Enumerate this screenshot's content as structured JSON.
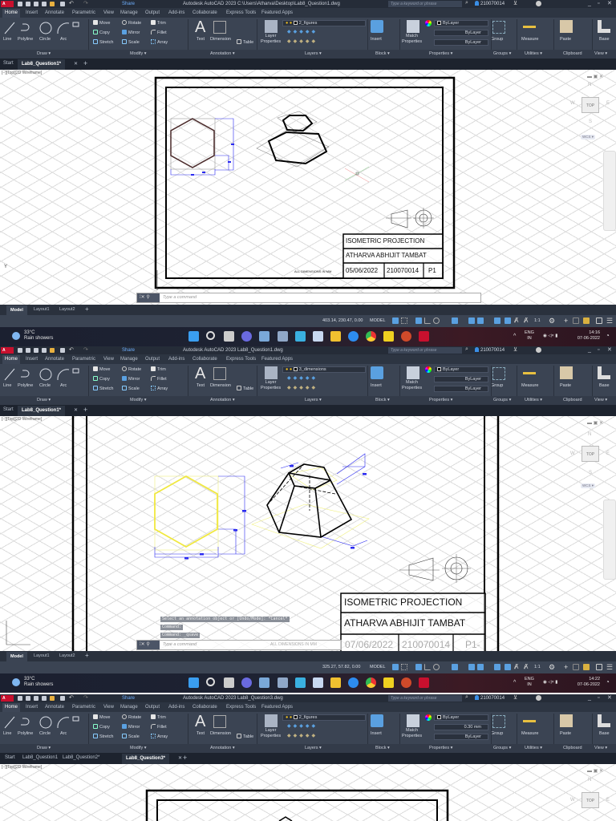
{
  "screens": [
    {
      "window_title": "Autodesk AutoCAD 2023    C:\\Users\\Atharva\\Desktop\\Lab8_Question1.dwg",
      "doc_tabs": [
        "Start",
        "Lab8_Question1*"
      ],
      "active_doc_tab": 1,
      "layer_name": "2_figures",
      "lineweight": "ByLayer",
      "linetype": "ByLayer",
      "color": "ByLayer",
      "coords": "403.14, 230.47, 0.00",
      "clock_time": "14:16",
      "clock_date": "07-06-2022"
    },
    {
      "window_title": "Autodesk AutoCAD 2023    Lab8_Question1.dwg",
      "doc_tabs": [
        "Start",
        "Lab8_Question1*"
      ],
      "active_doc_tab": 1,
      "layer_name": "3_dimensions",
      "lineweight": "ByLayer",
      "linetype": "ByLayer",
      "color": "ByLayer",
      "coords": "325.27, 57.82, 0.00",
      "clock_time": "14:22",
      "clock_date": "07-06-2022"
    },
    {
      "window_title": "Autodesk AutoCAD 2023    Lab8_Question3.dwg",
      "doc_tabs": [
        "Start",
        "Lab8_Question1",
        "Lab8_Question2*",
        "Lab8_Question3*"
      ],
      "active_doc_tab": 3,
      "layer_name": "2_figures",
      "lineweight": "0.30 mm",
      "linetype": "ByLayer",
      "color": "ByLayer"
    }
  ],
  "app": {
    "logo": "A CAD",
    "share": "Share",
    "search_placeholder": "Type a keyword or phrase",
    "user": "210070014",
    "ribbon_tabs": [
      "Home",
      "Insert",
      "Annotate",
      "Parametric",
      "View",
      "Manage",
      "Output",
      "Add-ins",
      "Collaborate",
      "Express Tools",
      "Featured Apps"
    ],
    "draw_tools": [
      "Line",
      "Polyline",
      "Circle",
      "Arc"
    ],
    "modify_tools": [
      "Move",
      "Rotate",
      "Trim",
      "Copy",
      "Mirror",
      "Fillet",
      "Stretch",
      "Scale",
      "Array"
    ],
    "text_tool": "Text",
    "dimension_tool": "Dimension",
    "table_tool": "Table",
    "layer_properties": [
      "Layer",
      "Properties"
    ],
    "insert_tool": "Insert",
    "match_properties": [
      "Match",
      "Properties"
    ],
    "group_tool": "Group",
    "measure_tool": "Measure",
    "paste_tool": "Paste",
    "base_tool": "Base",
    "panel_labels": [
      "Draw ▾",
      "Modify ▾",
      "Annotation ▾",
      "Layers ▾",
      "Block ▾",
      "Properties ▾",
      "Groups ▾",
      "Utilities ▾",
      "Clipboard",
      "View ▾"
    ],
    "viewport_label": "[−][Top][2D Wireframe]",
    "viewcube": {
      "top": "TOP",
      "n": "N",
      "s": "S",
      "e": "E",
      "w": "W",
      "wcs": "WCS ▾"
    },
    "command_placeholder": "Type a command",
    "layout_tabs": [
      "Model",
      "Layout1",
      "Layout2"
    ],
    "model_label": "MODEL",
    "scale": "1:1",
    "weather_temp": "33°C",
    "weather_desc": "Rain showers",
    "lang": [
      "ENG",
      "IN"
    ]
  },
  "drawing": {
    "title": "ISOMETRIC PROJECTION",
    "name": "ATHARVA ABHIJIT TAMBAT",
    "date_1": "05/06/2022",
    "date_2": "07/06/2022",
    "roll": "210070014",
    "sheet_1": "P1",
    "sheet_2": "P1-",
    "note": "ALL DIMENSIONS IN MM"
  },
  "command_history": [
    "Select an annotation object or [Undo/Mode]: *Cancel*",
    "Command:",
    "Command: _qsave"
  ],
  "colors": {
    "accent": "#3a8ee6",
    "autocad_red": "#c8102e",
    "dimension_blue": "#2a2af0",
    "figure_yellow": "#f0e840"
  }
}
